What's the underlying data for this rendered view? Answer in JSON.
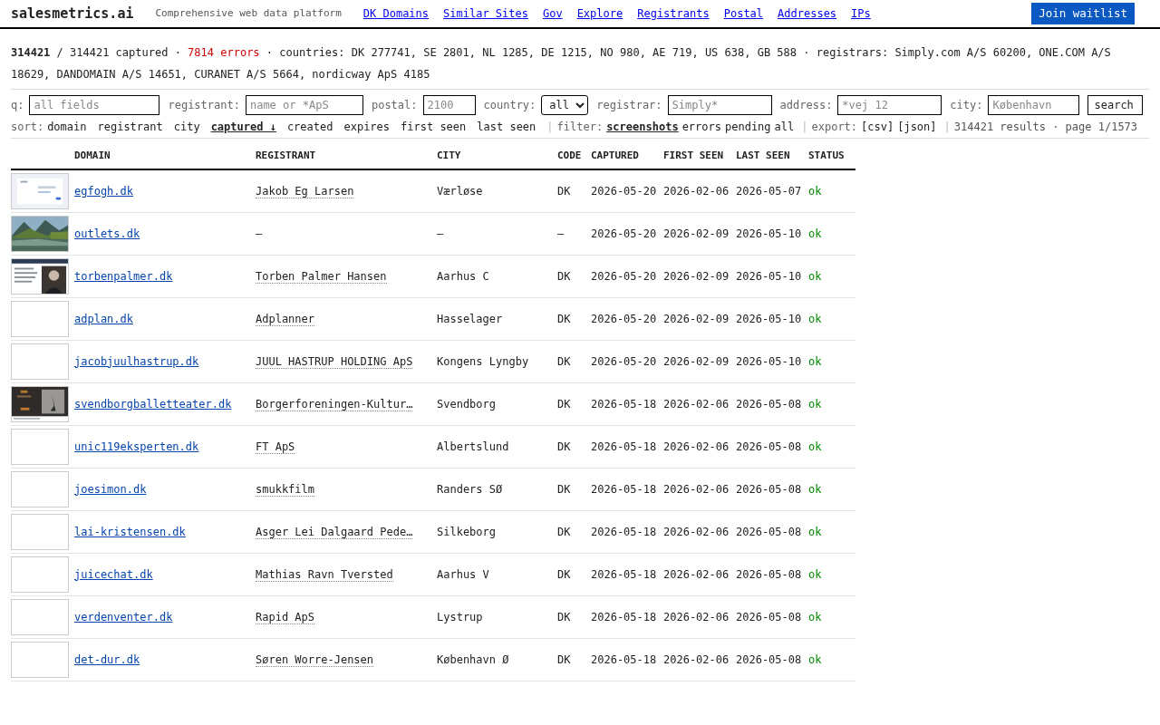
{
  "header": {
    "logo": "salesmetrics.ai",
    "tagline": "Comprehensive web data platform",
    "nav": [
      "DK Domains",
      "Similar Sites",
      "Gov",
      "Explore",
      "Registrants",
      "Postal",
      "Addresses",
      "IPs"
    ],
    "cta": "Join waitlist"
  },
  "summary": {
    "count": "314421",
    "rest": "/ 314421 captured ·",
    "errors": "7814 errors",
    "details": "· countries: DK 277741, SE 2801, NL 1285, DE 1215, NO 980, AE 719, US 638, GB 588 · registrars: Simply.com A/S 60200, ONE.COM A/S 18629, DANDOMAIN A/S 14651, CURANET A/S 5664, nordicway ApS 4185"
  },
  "filters": [
    {
      "kind": "input",
      "label": "q:",
      "placeholder": "all fields"
    },
    {
      "kind": "input",
      "label": "registrant:",
      "placeholder": "name or *ApS"
    },
    {
      "kind": "input",
      "label": "postal:",
      "placeholder": "2100"
    },
    {
      "kind": "select",
      "label": "country:",
      "value": "all"
    },
    {
      "kind": "input",
      "label": "registrar:",
      "placeholder": "Simply*"
    },
    {
      "kind": "input",
      "label": "address:",
      "placeholder": "*vej 12"
    },
    {
      "kind": "input",
      "label": "city:",
      "placeholder": "København"
    }
  ],
  "search_button": "search",
  "sort": {
    "label": "sort:",
    "options": [
      {
        "label": "domain",
        "selected": false
      },
      {
        "label": "registrant",
        "selected": false
      },
      {
        "label": "city",
        "selected": false
      },
      {
        "label": "captured ↓",
        "selected": true
      },
      {
        "label": "created",
        "selected": false
      },
      {
        "label": "expires",
        "selected": false
      },
      {
        "label": "first seen",
        "selected": false
      },
      {
        "label": "last seen",
        "selected": false
      }
    ]
  },
  "separator_1": "|",
  "filter": {
    "label": "filter:",
    "options": [
      {
        "label": "screenshots",
        "selected": true
      },
      {
        "label": "errors",
        "selected": false
      },
      {
        "label": "pending",
        "selected": false
      },
      {
        "label": "all",
        "selected": false
      }
    ]
  },
  "separator_2": "|",
  "export": {
    "label": "export:",
    "links": [
      "[csv]",
      "[json]"
    ]
  },
  "separator_3": "|",
  "results": "314421 results · page 1/1573",
  "table": {
    "columns": [
      "DOMAIN",
      "REGISTRANT",
      "CITY",
      "CODE",
      "CAPTURED",
      "FIRST SEEN",
      "LAST SEEN",
      "STATUS"
    ],
    "rows": [
      {
        "thumbnail": {
          "kind": "page"
        },
        "domain": "egfogh.dk",
        "registrant": "Jakob Eg Larsen",
        "city": "Værløse",
        "code": "DK",
        "captured": "2026-05-20",
        "first_seen": "2026-02-06",
        "last_seen": "2026-05-07",
        "status": "ok"
      },
      {
        "thumbnail": {
          "kind": "landscape"
        },
        "domain": "outlets.dk",
        "registrant": "—",
        "city": "—",
        "code": "—",
        "captured": "2026-05-20",
        "first_seen": "2026-02-09",
        "last_seen": "2026-05-10",
        "status": "ok"
      },
      {
        "thumbnail": {
          "kind": "portrait"
        },
        "domain": "torbenpalmer.dk",
        "registrant": "Torben Palmer Hansen",
        "city": "Aarhus C",
        "code": "DK",
        "captured": "2026-05-20",
        "first_seen": "2026-02-09",
        "last_seen": "2026-05-10",
        "status": "ok"
      },
      {
        "thumbnail": {
          "kind": "blank"
        },
        "domain": "adplan.dk",
        "registrant": "Adplanner",
        "city": "Hasselager",
        "code": "DK",
        "captured": "2026-05-20",
        "first_seen": "2026-02-09",
        "last_seen": "2026-05-10",
        "status": "ok"
      },
      {
        "thumbnail": {
          "kind": "blank"
        },
        "domain": "jacobjuulhastrup.dk",
        "registrant": "JUUL HASTRUP HOLDING ApS",
        "city": "Kongens Lyngby",
        "code": "DK",
        "captured": "2026-05-20",
        "first_seen": "2026-02-09",
        "last_seen": "2026-05-10",
        "status": "ok"
      },
      {
        "thumbnail": {
          "kind": "dark"
        },
        "domain": "svendborgballetteater.dk",
        "registrant": "Borgerforeningen-Kultur…",
        "city": "Svendborg",
        "code": "DK",
        "captured": "2026-05-18",
        "first_seen": "2026-02-06",
        "last_seen": "2026-05-08",
        "status": "ok"
      },
      {
        "thumbnail": {
          "kind": "blank"
        },
        "domain": "unic119eksperten.dk",
        "registrant": "FT ApS",
        "city": "Albertslund",
        "code": "DK",
        "captured": "2026-05-18",
        "first_seen": "2026-02-06",
        "last_seen": "2026-05-08",
        "status": "ok"
      },
      {
        "thumbnail": {
          "kind": "blank"
        },
        "domain": "joesimon.dk",
        "registrant": "smukkfilm",
        "city": "Randers SØ",
        "code": "DK",
        "captured": "2026-05-18",
        "first_seen": "2026-02-06",
        "last_seen": "2026-05-08",
        "status": "ok"
      },
      {
        "thumbnail": {
          "kind": "blank"
        },
        "domain": "lai-kristensen.dk",
        "registrant": "Asger Lei Dalgaard Pede…",
        "city": "Silkeborg",
        "code": "DK",
        "captured": "2026-05-18",
        "first_seen": "2026-02-06",
        "last_seen": "2026-05-08",
        "status": "ok"
      },
      {
        "thumbnail": {
          "kind": "blank"
        },
        "domain": "juicechat.dk",
        "registrant": "Mathias Ravn Tversted",
        "city": "Aarhus V",
        "code": "DK",
        "captured": "2026-05-18",
        "first_seen": "2026-02-06",
        "last_seen": "2026-05-08",
        "status": "ok"
      },
      {
        "thumbnail": {
          "kind": "blank"
        },
        "domain": "verdenventer.dk",
        "registrant": "Rapid ApS",
        "city": "Lystrup",
        "code": "DK",
        "captured": "2026-05-18",
        "first_seen": "2026-02-06",
        "last_seen": "2026-05-08",
        "status": "ok"
      },
      {
        "thumbnail": {
          "kind": "blank"
        },
        "domain": "det-dur.dk",
        "registrant": "Søren Worre-Jensen",
        "city": "København Ø",
        "code": "DK",
        "captured": "2026-05-18",
        "first_seen": "2026-02-06",
        "last_seen": "2026-05-08",
        "status": "ok"
      }
    ]
  }
}
